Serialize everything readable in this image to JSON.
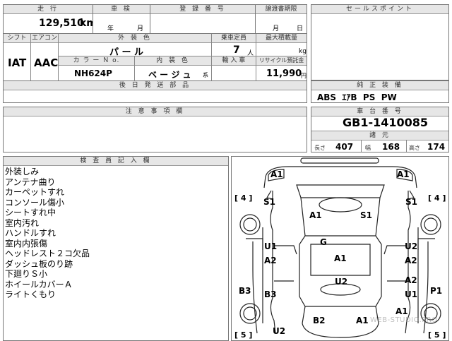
{
  "headers": {
    "mileage": "走 行",
    "inspection": "車 検",
    "registration": "登 録 番 号",
    "transfer_deadline": "譲渡書期限",
    "sales_point": "セールスポイント",
    "shift": "シフト",
    "aircon": "エアコン",
    "ext_color": "外 装 色",
    "capacity": "乗車定員",
    "max_load": "最大積載量",
    "color_no": "カ ラ ー Ｎ o.",
    "int_color": "内 装 色",
    "import": "輸 入 車",
    "recycle": "リサイクル預託金",
    "later_docs": "後 日 発 送 部 品",
    "genuine_equip": "純 正 装 備",
    "notes": "注 意 事 項 欄",
    "chassis": "車 台 番 号",
    "dimensions": "諸 元",
    "inspector": "検 査 員 記 入 欄"
  },
  "vehicle": {
    "mileage": "129,510",
    "mileage_unit": "km",
    "year_label": "年",
    "month_label": "月",
    "transfer_month": "月",
    "transfer_day": "日",
    "shift": "IAT",
    "aircon": "AAC",
    "ext_color": "パ ー ル",
    "capacity": "7",
    "capacity_unit": "人",
    "load_unit": "kg",
    "color_no": "NH624P",
    "int_color": "ベ ー ジ ュ",
    "int_suffix": "系",
    "recycle": "11,990",
    "recycle_unit": "円",
    "equipment": "ABS  ｴｱB  PS  PW",
    "chassis_no": "GB1-1410085",
    "length_label": "長さ",
    "length": "407",
    "width_label": "幅",
    "width": "168",
    "height_label": "高さ",
    "height": "174"
  },
  "remarks": [
    "外装しみ",
    "アンテナ曲り",
    "カーペットすれ",
    "コンソール傷小",
    "シートすれ中",
    "室内汚れ",
    "ハンドルすれ",
    "室内内張傷",
    "ヘッドレスト２コ欠品",
    "ダッシュ板のり跡",
    "下廻りＳ小",
    "ホイールカバーＡ",
    "ライトくもり"
  ],
  "diagram": {
    "marks": [
      "A1",
      "A1",
      "S1",
      "S1",
      "A1",
      "S1",
      "U1",
      "U2",
      "A2",
      "A2",
      "G",
      "A1",
      "U2",
      "B3",
      "B3",
      "U1",
      "P1",
      "A1",
      "U2",
      "B2",
      "A1",
      "A2",
      "[ 4 ]",
      "[ 4 ]",
      "[ 5 ]",
      "[ 5 ]"
    ],
    "watermark": "WEB-STUDIO.PRO"
  }
}
